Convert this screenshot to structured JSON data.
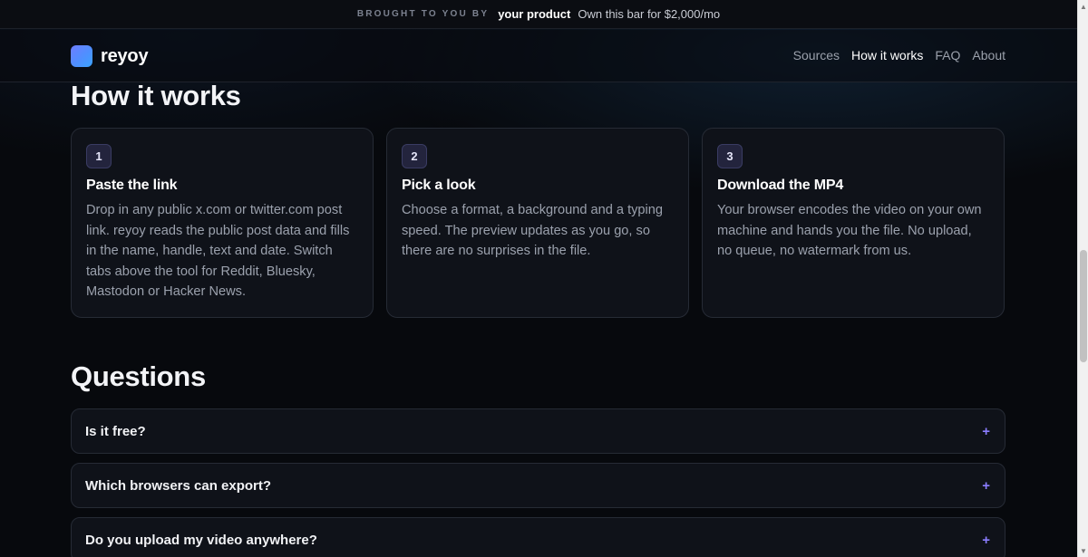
{
  "sponsor": {
    "kicker": "BROUGHT TO YOU BY",
    "product": "your product",
    "cta": "Own this bar for $2,000/mo"
  },
  "header": {
    "brand": "reyoy",
    "nav": [
      {
        "label": "Sources",
        "active": false
      },
      {
        "label": "How it works",
        "active": true
      },
      {
        "label": "FAQ",
        "active": false
      },
      {
        "label": "About",
        "active": false
      }
    ]
  },
  "how": {
    "title": "How it works",
    "steps": [
      {
        "number": "1",
        "title": "Paste the link",
        "body": "Drop in any public x.com or twitter.com post link. reyoy reads the public post data and fills in the name, handle, text and date. Switch tabs above the tool for Reddit, Bluesky, Mastodon or Hacker News."
      },
      {
        "number": "2",
        "title": "Pick a look",
        "body": "Choose a format, a background and a typing speed. The preview updates as you go, so there are no surprises in the file."
      },
      {
        "number": "3",
        "title": "Download the MP4",
        "body": "Your browser encodes the video on your own machine and hands you the file. No upload, no queue, no watermark from us."
      }
    ]
  },
  "faq": {
    "title": "Questions",
    "items": [
      {
        "question": "Is it free?",
        "toggle": "+"
      },
      {
        "question": "Which browsers can export?",
        "toggle": "+"
      },
      {
        "question": "Do you upload my video anywhere?",
        "toggle": "+"
      }
    ]
  },
  "colors": {
    "background": "#07090d",
    "card": "#0f1219",
    "border": "#262b35",
    "accent": "#8b7dff",
    "logo_gradient_start": "#6e7dff",
    "logo_gradient_end": "#3aa3ff"
  },
  "icons": {
    "faq_toggle": "plus-icon",
    "scroll_up": "arrow-up-icon",
    "scroll_down": "arrow-down-icon"
  }
}
